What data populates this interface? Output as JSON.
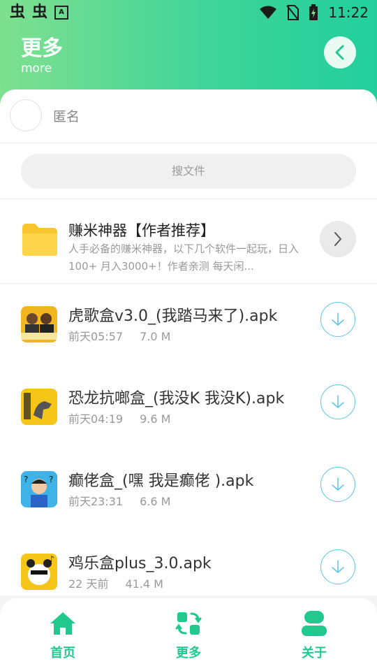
{
  "status_bar": {
    "time": "11:22",
    "app_icon_char": "虫",
    "a_badge": "A"
  },
  "header": {
    "title": "更多",
    "subtitle": "more"
  },
  "user": {
    "name": "匿名"
  },
  "search": {
    "placeholder": "搜文件"
  },
  "promo": {
    "title": "赚米神器【作者推荐】",
    "description": "人手必备的赚米神器，以下几个软件一起玩，日入100+ 月入3000+！作者亲测 每天闲..."
  },
  "files": [
    {
      "name": "虎歌盒v3.0_(我踏马来了).apk",
      "time": "前天05:57",
      "size": "7.0 M"
    },
    {
      "name": "恐龙抗啷盒_(我没K 我没K).apk",
      "time": "前天04:19",
      "size": "9.6 M"
    },
    {
      "name": "癫佬盒_(嘿 我是癫佬 ).apk",
      "time": "前天23:31",
      "size": "6.6 M"
    },
    {
      "name": "鸡乐盒plus_3.0.apk",
      "time": "22 天前",
      "size": "41.4 M"
    }
  ],
  "tabs": [
    {
      "label": "首页",
      "icon": "home-icon"
    },
    {
      "label": "更多",
      "icon": "refresh-grid-icon"
    },
    {
      "label": "关于",
      "icon": "person-icon"
    }
  ],
  "colors": {
    "accent": "#22c98f",
    "header_start": "#7fe08f",
    "header_end": "#22cf9c",
    "download_ring": "#5cc6e6"
  }
}
